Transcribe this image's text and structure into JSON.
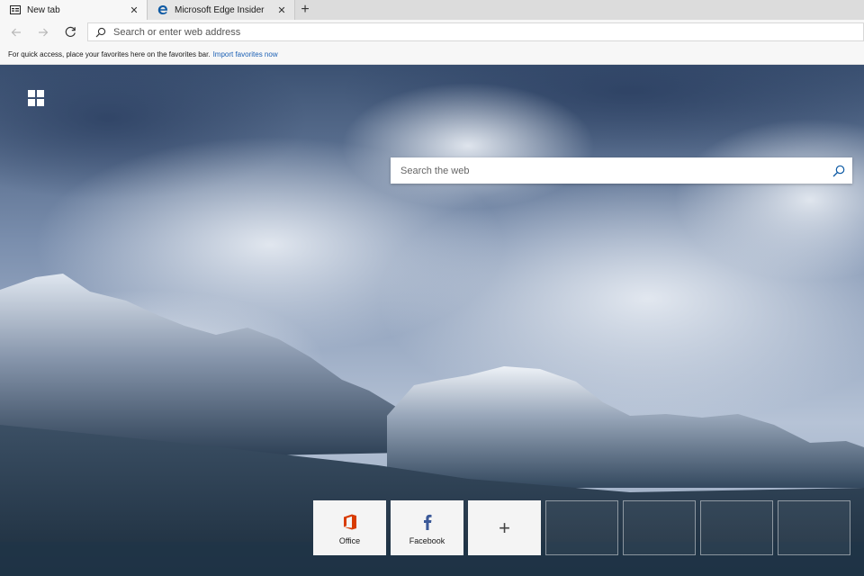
{
  "tabs": [
    {
      "title": "New tab",
      "icon": "new-tab-page-icon",
      "active": true
    },
    {
      "title": "Microsoft Edge Insider",
      "icon": "edge-logo-icon",
      "active": false
    }
  ],
  "address": {
    "placeholder": "Search or enter web address"
  },
  "favorites_bar": {
    "message": "For quick access, place your favorites here on the favorites bar.",
    "link": "Import favorites now"
  },
  "search": {
    "placeholder": "Search the web"
  },
  "tiles": [
    {
      "label": "Office",
      "icon": "office-icon"
    },
    {
      "label": "Facebook",
      "icon": "facebook-icon"
    }
  ],
  "colors": {
    "office": "#d83b01",
    "facebook": "#3b5998",
    "edge": "#0c59a4",
    "link": "#1a5fb4"
  }
}
